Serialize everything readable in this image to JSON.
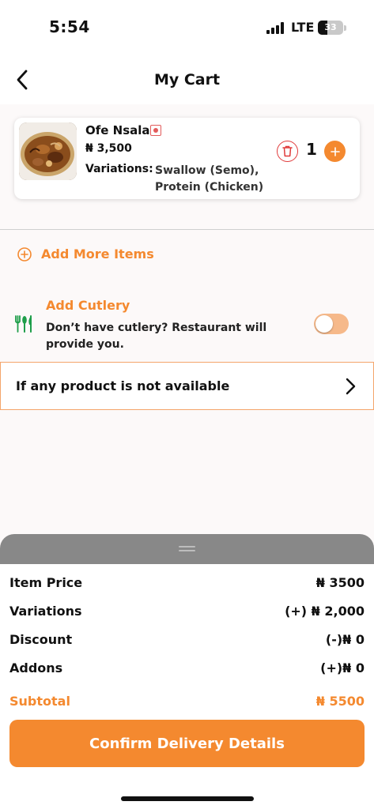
{
  "status_bar": {
    "time": "5:54",
    "network": "LTE",
    "battery": "33"
  },
  "header": {
    "title": "My Cart"
  },
  "cart_item": {
    "name": "Ofe Nsala",
    "price": "₦ 3,500",
    "variations_label": "Variations:",
    "variations_value": "Swallow (Semo), Protein (Chicken)",
    "quantity": "1"
  },
  "add_more": {
    "label": "Add More Items"
  },
  "cutlery": {
    "title": "Add Cutlery",
    "description": "Don’t have cutlery? Restaurant will provide you.",
    "enabled": false
  },
  "unavailable": {
    "label": "If any product is not available"
  },
  "summary": {
    "item_price_label": "Item Price",
    "item_price_value": "₦ 3500",
    "variations_label": "Variations",
    "variations_value": "(+) ₦ 2,000",
    "discount_label": "Discount",
    "discount_value": "(-)₦ 0",
    "addons_label": "Addons",
    "addons_value": "(+)₦ 0",
    "subtotal_label": "Subtotal",
    "subtotal_value": "₦ 5500"
  },
  "confirm_button": {
    "label": "Confirm Delivery Details"
  },
  "colors": {
    "accent": "#f4892f",
    "danger": "#e03a3a",
    "cutlery_icon": "#1e9e4a",
    "sheet_handle": "#888888"
  }
}
